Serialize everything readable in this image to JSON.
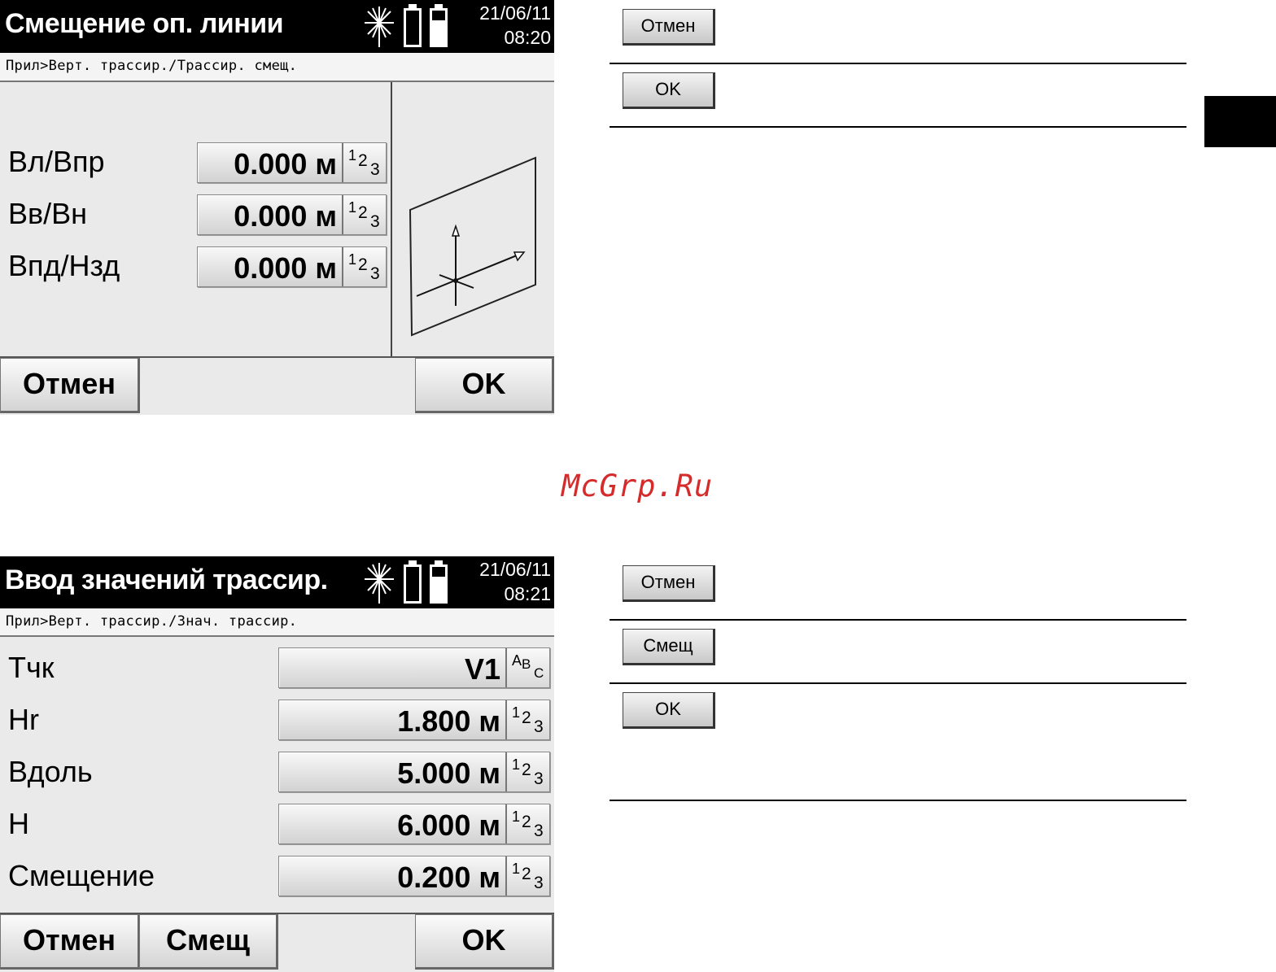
{
  "screen1": {
    "title": "Смещение оп. линии",
    "date": "21/06/11",
    "time": "08:20",
    "breadcrumb": "Прил>Верт. трассир./Трассир. смещ.",
    "fields": [
      {
        "label": "Вл/Впр",
        "value": "0.000 м",
        "mode": [
          "1",
          "2",
          "3"
        ]
      },
      {
        "label": "Вв/Вн",
        "value": "0.000 м",
        "mode": [
          "1",
          "2",
          "3"
        ]
      },
      {
        "label": "Впд/Нзд",
        "value": "0.000 м",
        "mode": [
          "1",
          "2",
          "3"
        ]
      }
    ],
    "softkeys": {
      "cancel": "Отмен",
      "ok": "OK"
    }
  },
  "screen2": {
    "title": "Ввод значений трассир.",
    "date": "21/06/11",
    "time": "08:21",
    "breadcrumb": "Прил>Верт. трассир./Знач. трассир.",
    "fields": [
      {
        "label": "Тчк",
        "value": "V1",
        "mode": [
          "A",
          "B",
          "C"
        ]
      },
      {
        "label": "Hr",
        "value": "1.800 м",
        "mode": [
          "1",
          "2",
          "3"
        ]
      },
      {
        "label": "Вдоль",
        "value": "5.000 м",
        "mode": [
          "1",
          "2",
          "3"
        ]
      },
      {
        "label": "Н",
        "value": "6.000 м",
        "mode": [
          "1",
          "2",
          "3"
        ]
      },
      {
        "label": "Смещение",
        "value": "0.200 м",
        "mode": [
          "1",
          "2",
          "3"
        ]
      }
    ],
    "softkeys": {
      "cancel": "Отмен",
      "offset": "Смещ",
      "ok": "OK"
    }
  },
  "legend1": {
    "cancel": "Отмен",
    "ok": "OK"
  },
  "legend2": {
    "cancel": "Отмен",
    "offset": "Смещ",
    "ok": "OK"
  },
  "watermark": "McGrp.Ru",
  "icons": [
    "laser-icon",
    "battery-icon"
  ],
  "colors": {
    "titlebar": "#000000",
    "screen_bg": "#eaeaea",
    "watermark": "#d52b2b"
  }
}
